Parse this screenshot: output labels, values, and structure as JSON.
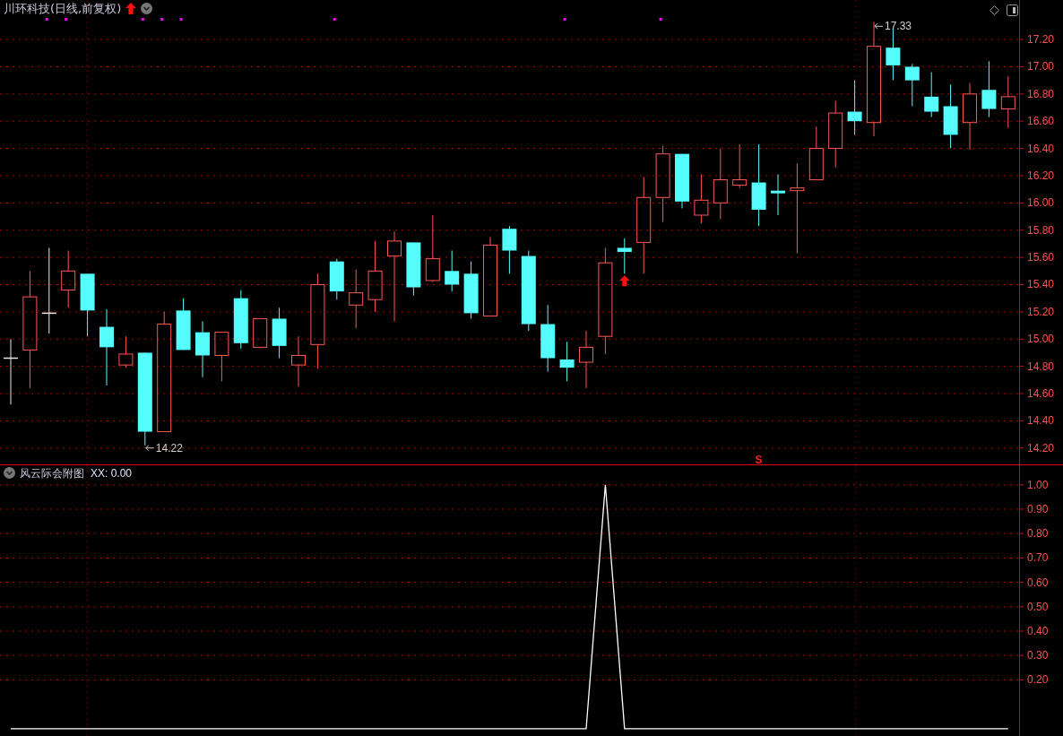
{
  "title": "川环科技(日线,前复权)",
  "price_chart": {
    "chart_data": {
      "type": "candlestick",
      "grid": true,
      "ylim": [
        14.08,
        17.49
      ],
      "categories": [
        null,
        null,
        null,
        null,
        null,
        null,
        null,
        null,
        null,
        null,
        null,
        null,
        null,
        null,
        null,
        null,
        null,
        null,
        null,
        null,
        null,
        null,
        null,
        null,
        null,
        null,
        null,
        null,
        null,
        null,
        null,
        null,
        null,
        null,
        null,
        null,
        null,
        null,
        null,
        null,
        null,
        null,
        null,
        null,
        null,
        null,
        null,
        null,
        null,
        null,
        null,
        null,
        null
      ],
      "yticks": [
        {
          "value": 14.2,
          "label": "14.20"
        },
        {
          "value": 14.4,
          "label": "14.40"
        },
        {
          "value": 14.6,
          "label": "14.60"
        },
        {
          "value": 14.8,
          "label": "14.80"
        },
        {
          "value": 15.0,
          "label": "15.00"
        },
        {
          "value": 15.2,
          "label": "15.20"
        },
        {
          "value": 15.4,
          "label": "15.40"
        },
        {
          "value": 15.6,
          "label": "15.60"
        },
        {
          "value": 15.8,
          "label": "15.80"
        },
        {
          "value": 16.0,
          "label": "16.00"
        },
        {
          "value": 16.2,
          "label": "16.20"
        },
        {
          "value": 16.4,
          "label": "16.40"
        },
        {
          "value": 16.6,
          "label": "16.60"
        },
        {
          "value": 16.8,
          "label": "16.80"
        },
        {
          "value": 17.0,
          "label": "17.00"
        },
        {
          "value": 17.2,
          "label": "17.20"
        }
      ],
      "ohlc": [
        [
          14.86,
          15.0,
          14.52,
          14.86
        ],
        [
          14.92,
          15.5,
          14.64,
          15.31
        ],
        [
          15.19,
          15.67,
          15.04,
          15.19
        ],
        [
          15.36,
          15.65,
          15.23,
          15.5
        ],
        [
          15.48,
          15.48,
          15.02,
          15.21
        ],
        [
          15.09,
          15.22,
          14.66,
          14.94
        ],
        [
          14.81,
          15.02,
          14.79,
          14.89
        ],
        [
          14.9,
          14.9,
          14.22,
          14.32
        ],
        [
          14.32,
          15.2,
          14.32,
          15.11
        ],
        [
          15.21,
          15.3,
          14.92,
          14.92
        ],
        [
          15.05,
          15.13,
          14.72,
          14.88
        ],
        [
          14.88,
          15.05,
          14.69,
          15.05
        ],
        [
          15.3,
          15.36,
          14.93,
          14.97
        ],
        [
          14.94,
          15.15,
          14.94,
          15.15
        ],
        [
          15.15,
          15.23,
          14.86,
          14.95
        ],
        [
          14.81,
          15.02,
          14.65,
          14.88
        ],
        [
          14.96,
          15.48,
          14.78,
          15.4
        ],
        [
          15.57,
          15.59,
          15.29,
          15.35
        ],
        [
          15.25,
          15.51,
          15.08,
          15.34
        ],
        [
          15.29,
          15.72,
          15.2,
          15.5
        ],
        [
          15.61,
          15.79,
          15.13,
          15.72
        ],
        [
          15.71,
          15.71,
          15.32,
          15.38
        ],
        [
          15.43,
          15.91,
          15.42,
          15.59
        ],
        [
          15.5,
          15.65,
          15.35,
          15.4
        ],
        [
          15.48,
          15.57,
          15.15,
          15.19
        ],
        [
          15.17,
          15.75,
          15.17,
          15.69
        ],
        [
          15.81,
          15.83,
          15.48,
          15.65
        ],
        [
          15.61,
          15.65,
          15.06,
          15.11
        ],
        [
          15.11,
          15.25,
          14.76,
          14.86
        ],
        [
          14.85,
          14.98,
          14.69,
          14.79
        ],
        [
          14.83,
          15.06,
          14.64,
          14.94
        ],
        [
          15.02,
          15.67,
          14.89,
          15.56
        ],
        [
          15.67,
          15.74,
          15.48,
          15.64
        ],
        [
          15.71,
          16.19,
          15.48,
          16.04
        ],
        [
          16.04,
          16.42,
          15.86,
          16.36
        ],
        [
          16.36,
          16.36,
          15.96,
          16.01
        ],
        [
          15.91,
          16.21,
          15.85,
          16.02
        ],
        [
          16.0,
          16.4,
          15.88,
          16.17
        ],
        [
          16.13,
          16.43,
          16.11,
          16.17
        ],
        [
          16.15,
          16.43,
          15.83,
          15.95
        ],
        [
          16.09,
          16.21,
          15.91,
          16.07
        ],
        [
          16.09,
          16.29,
          15.63,
          16.11
        ],
        [
          16.17,
          16.56,
          16.17,
          16.4
        ],
        [
          16.4,
          16.75,
          16.26,
          16.66
        ],
        [
          16.67,
          16.9,
          16.5,
          16.6
        ],
        [
          16.59,
          17.33,
          16.49,
          17.15
        ],
        [
          17.14,
          17.28,
          16.9,
          17.01
        ],
        [
          17.0,
          17.02,
          16.71,
          16.9
        ],
        [
          16.78,
          16.96,
          16.63,
          16.67
        ],
        [
          16.71,
          16.87,
          16.4,
          16.5
        ],
        [
          16.59,
          16.88,
          16.39,
          16.8
        ],
        [
          16.83,
          17.04,
          16.63,
          16.69
        ],
        [
          16.69,
          16.93,
          16.55,
          16.78
        ]
      ],
      "annotations": [
        {
          "text": "17.33"
        },
        {
          "text": "14.22"
        }
      ]
    },
    "sell_label": "S",
    "candle_signals": [
      {
        "dot": false,
        "arrow": false,
        "sell": false
      },
      {
        "dot": false,
        "arrow": false,
        "sell": false
      },
      {
        "dot": true,
        "arrow": false,
        "sell": false
      },
      {
        "dot": true,
        "arrow": false,
        "sell": false
      },
      {
        "dot": false,
        "arrow": false,
        "sell": false
      },
      {
        "dot": false,
        "arrow": false,
        "sell": false
      },
      {
        "dot": false,
        "arrow": false,
        "sell": false
      },
      {
        "dot": true,
        "arrow": false,
        "sell": false
      },
      {
        "dot": true,
        "arrow": false,
        "sell": false
      },
      {
        "dot": true,
        "arrow": false,
        "sell": false
      },
      {
        "dot": false,
        "arrow": false,
        "sell": false
      },
      {
        "dot": false,
        "arrow": false,
        "sell": false
      },
      {
        "dot": false,
        "arrow": false,
        "sell": false
      },
      {
        "dot": false,
        "arrow": false,
        "sell": false
      },
      {
        "dot": false,
        "arrow": false,
        "sell": false
      },
      {
        "dot": false,
        "arrow": false,
        "sell": false
      },
      {
        "dot": false,
        "arrow": false,
        "sell": false
      },
      {
        "dot": true,
        "arrow": false,
        "sell": false
      },
      {
        "dot": false,
        "arrow": false,
        "sell": false
      },
      {
        "dot": false,
        "arrow": false,
        "sell": false
      },
      {
        "dot": false,
        "arrow": false,
        "sell": false
      },
      {
        "dot": false,
        "arrow": false,
        "sell": false
      },
      {
        "dot": false,
        "arrow": false,
        "sell": false
      },
      {
        "dot": false,
        "arrow": false,
        "sell": false
      },
      {
        "dot": false,
        "arrow": false,
        "sell": false
      },
      {
        "dot": false,
        "arrow": false,
        "sell": false
      },
      {
        "dot": false,
        "arrow": false,
        "sell": false
      },
      {
        "dot": false,
        "arrow": false,
        "sell": false
      },
      {
        "dot": false,
        "arrow": false,
        "sell": false
      },
      {
        "dot": true,
        "arrow": false,
        "sell": false
      },
      {
        "dot": false,
        "arrow": false,
        "sell": false
      },
      {
        "dot": false,
        "arrow": false,
        "sell": false
      },
      {
        "dot": false,
        "arrow": true,
        "sell": false
      },
      {
        "dot": false,
        "arrow": false,
        "sell": false
      },
      {
        "dot": true,
        "arrow": false,
        "sell": false
      },
      {
        "dot": false,
        "arrow": false,
        "sell": false
      },
      {
        "dot": false,
        "arrow": false,
        "sell": false
      },
      {
        "dot": false,
        "arrow": false,
        "sell": false
      },
      {
        "dot": false,
        "arrow": false,
        "sell": false
      },
      {
        "dot": false,
        "arrow": false,
        "sell": true
      },
      {
        "dot": false,
        "arrow": false,
        "sell": false
      },
      {
        "dot": false,
        "arrow": false,
        "sell": false
      },
      {
        "dot": false,
        "arrow": false,
        "sell": false
      },
      {
        "dot": false,
        "arrow": false,
        "sell": false
      },
      {
        "dot": false,
        "arrow": false,
        "sell": false
      },
      {
        "dot": false,
        "arrow": false,
        "sell": false
      },
      {
        "dot": false,
        "arrow": false,
        "sell": false
      },
      {
        "dot": false,
        "arrow": false,
        "sell": false
      },
      {
        "dot": false,
        "arrow": false,
        "sell": false
      },
      {
        "dot": false,
        "arrow": false,
        "sell": false
      },
      {
        "dot": false,
        "arrow": false,
        "sell": false
      },
      {
        "dot": false,
        "arrow": false,
        "sell": false
      },
      {
        "dot": false,
        "arrow": false,
        "sell": false
      }
    ]
  },
  "indicator": {
    "name": "风云际会附图",
    "reading": "XX: 0.00",
    "chart_data": {
      "type": "line",
      "grid": true,
      "ylim": [
        -0.03,
        1.08
      ],
      "categories": [
        null,
        null,
        null,
        null,
        null,
        null,
        null,
        null,
        null,
        null,
        null,
        null,
        null,
        null,
        null,
        null,
        null,
        null,
        null,
        null,
        null,
        null,
        null,
        null,
        null,
        null,
        null,
        null,
        null,
        null,
        null,
        null,
        null,
        null,
        null,
        null,
        null,
        null,
        null,
        null,
        null,
        null,
        null,
        null,
        null,
        null,
        null,
        null,
        null,
        null,
        null,
        null,
        null
      ],
      "yticks": [
        {
          "value": 0.2,
          "label": "0.20"
        },
        {
          "value": 0.3,
          "label": "0.30"
        },
        {
          "value": 0.4,
          "label": "0.40"
        },
        {
          "value": 0.5,
          "label": "0.50"
        },
        {
          "value": 0.6,
          "label": "0.60"
        },
        {
          "value": 0.7,
          "label": "0.70"
        },
        {
          "value": 0.8,
          "label": "0.80"
        },
        {
          "value": 0.9,
          "label": "0.90"
        },
        {
          "value": 1.0,
          "label": "1.00"
        }
      ],
      "series": [
        {
          "color": "#ffffff",
          "values": [
            0,
            0,
            0,
            0,
            0,
            0,
            0,
            0,
            0,
            0,
            0,
            0,
            0,
            0,
            0,
            0,
            0,
            0,
            0,
            0,
            0,
            0,
            0,
            0,
            0,
            0,
            0,
            0,
            0,
            0,
            0,
            1,
            0,
            0,
            0,
            0,
            0,
            0,
            0,
            0,
            0,
            0,
            0,
            0,
            0,
            0,
            0,
            0,
            0,
            0,
            0,
            0,
            0
          ]
        }
      ]
    }
  }
}
